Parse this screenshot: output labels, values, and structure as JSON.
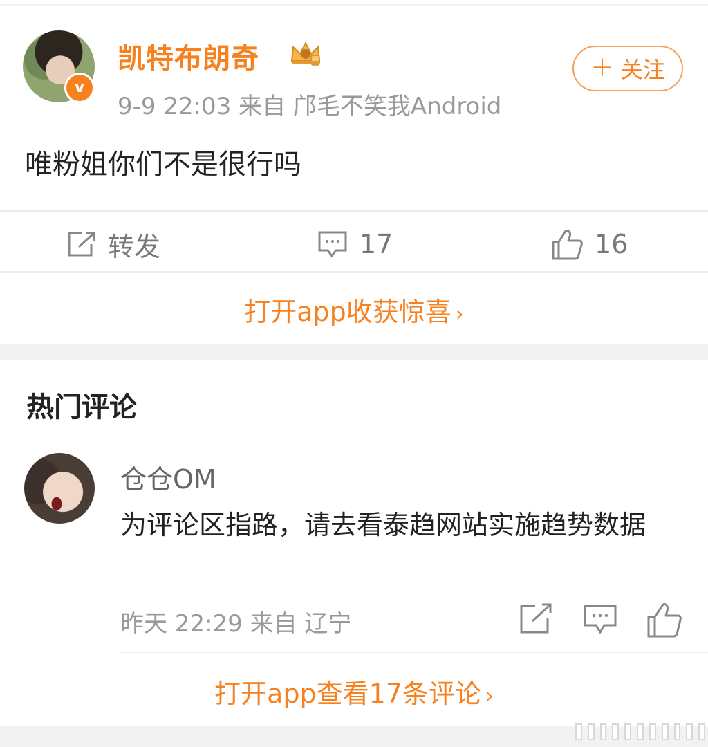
{
  "post": {
    "author": "凯特布朗奇",
    "meta": "9-9 22:03 来自 邝毛不笑我Android",
    "follow_label": "关注",
    "content": "唯粉姐你们不是很行吗",
    "actions": {
      "repost_label": "转发",
      "comment_count": "17",
      "like_count": "16"
    },
    "open_app_label": "打开app收获惊喜"
  },
  "hot_comments": {
    "title": "热门评论",
    "items": [
      {
        "name": "仓仓OM",
        "text": "为评论区指路，请去看泰趋网站实施趋势数据",
        "meta": "昨天 22:29 来自 辽宁"
      }
    ],
    "open_app_label": "打开app查看17条评论"
  },
  "icons": {
    "verified": "verified-v-badge-icon",
    "crown": "crown-badge-icon",
    "repost": "repost-icon",
    "comment": "comment-icon",
    "like": "thumb-up-icon",
    "chevron": "chevron-right-icon"
  },
  "colors": {
    "accent": "#f7811f",
    "muted": "#999999",
    "text": "#222222"
  }
}
